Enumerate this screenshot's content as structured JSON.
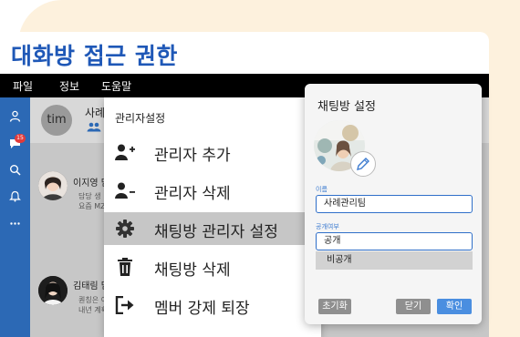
{
  "page_title": "대화방 접근 권한",
  "menubar": {
    "file": "파일",
    "info": "정보",
    "help": "도움말"
  },
  "sidebar": {
    "badge": "15"
  },
  "chat": {
    "avatar_initials": "tim",
    "room_name": "사례",
    "messages": [
      {
        "name": "이지영 담",
        "line1": "담당 생",
        "line2": "요즘 MZ"
      },
      {
        "name": "김태림 담",
        "line1": "퀀칭은 이",
        "line2": "내년 계획"
      }
    ]
  },
  "popup_menu": {
    "header": "관리자설정",
    "items": [
      {
        "label": "관리자 추가",
        "icon": "add-admin-icon"
      },
      {
        "label": "관리자 삭제",
        "icon": "remove-admin-icon"
      },
      {
        "label": "채팅방 관리자 설정",
        "icon": "gear-icon"
      },
      {
        "label": "채팅방 삭제",
        "icon": "trash-icon"
      },
      {
        "label": "멤버 강제 퇴장",
        "icon": "exit-icon"
      }
    ]
  },
  "dialog": {
    "title": "채팅방 설정",
    "name_label": "이름",
    "name_value": "사례관리팀",
    "visibility_label": "공개여부",
    "visibility_value": "공개",
    "visibility_option": "비공개",
    "reset_button": "초기화",
    "close_button": "닫기",
    "confirm_button": "확인"
  },
  "colors": {
    "title": "#1f58b7",
    "sidebar": "#2c69b5",
    "accent": "#3c7bd0",
    "background_blob": "#fdf1dd"
  }
}
